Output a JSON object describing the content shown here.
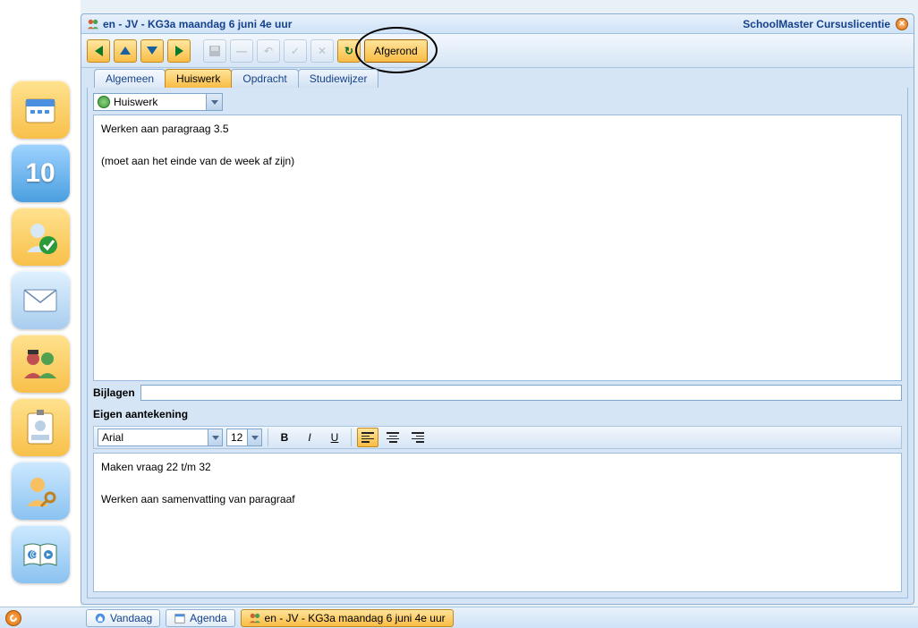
{
  "window": {
    "title": "en - JV - KG3a maandag 6 juni 4e uur",
    "brand": "SchoolMaster Cursuslicentie"
  },
  "toolbar": {
    "afgerond": "Afgerond"
  },
  "tabs": {
    "algemeen": "Algemeen",
    "huiswerk": "Huiswerk",
    "opdracht": "Opdracht",
    "studiewijzer": "Studiewijzer"
  },
  "dropdown": {
    "value": "Huiswerk"
  },
  "homework_text": "Werken aan paragraag 3.5\n\n(moet aan het einde van de week af zijn)",
  "bijlagen": {
    "label": "Bijlagen",
    "value": ""
  },
  "notes_label": "Eigen aantekening",
  "editor": {
    "font": "Arial",
    "size": "12"
  },
  "notes_text": "Maken vraag 22 t/m 32\n\nWerken aan samenvatting van paragraaf",
  "taskbar": {
    "vandaag": "Vandaag",
    "agenda": "Agenda",
    "current": "en - JV - KG3a maandag 6 juni 4e uur"
  }
}
